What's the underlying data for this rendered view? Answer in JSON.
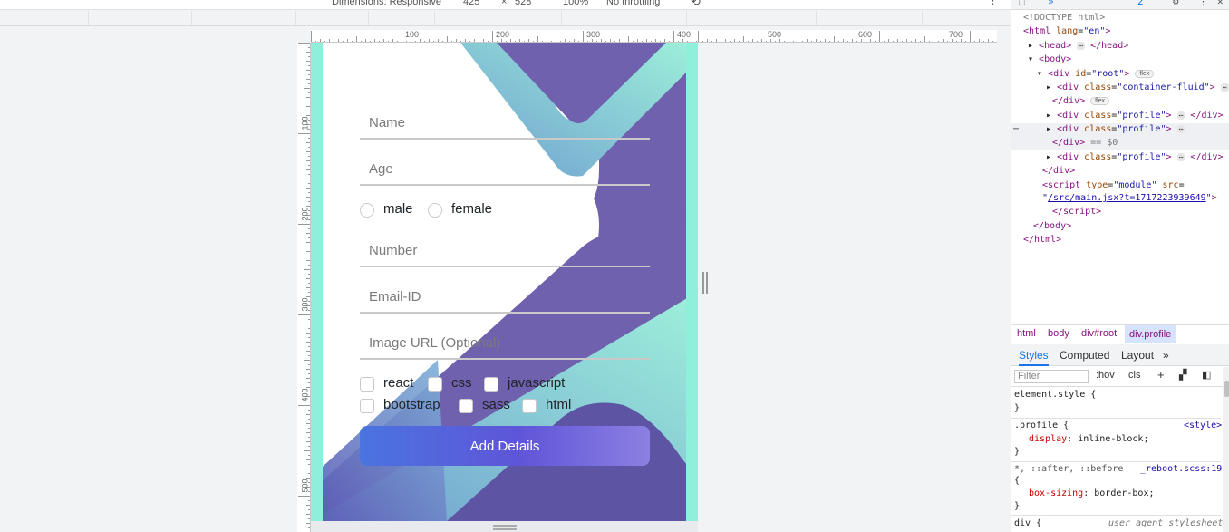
{
  "toolbar": {
    "dimensions_label": "Dimensions: Responsive",
    "width_value": "425",
    "x_sep": "×",
    "height_value": "528",
    "zoom": "100%",
    "throttling": "No throttling"
  },
  "ruler": {
    "h_ticks": [
      "100",
      "200",
      "300",
      "400",
      "500",
      "600",
      "700"
    ],
    "v_ticks": [
      "100",
      "200",
      "300",
      "400",
      "500"
    ]
  },
  "form": {
    "name_placeholder": "Name",
    "age_placeholder": "Age",
    "gender_options": [
      "male",
      "female"
    ],
    "number_placeholder": "Number",
    "email_placeholder": "Email-ID",
    "image_placeholder": "Image URL (Optional)",
    "skills_row1": [
      "react",
      "css",
      "javascript"
    ],
    "skills_row2": [
      "bootstrap",
      "sass",
      "html"
    ],
    "submit_label": "Add Details"
  },
  "colors": {
    "purple": "#6f61ad",
    "dark_purple": "#5d54a4",
    "teal": "#8ef0da",
    "blue": "#6f9fd0"
  },
  "devtools": {
    "top_badge": "2",
    "dom": {
      "doctype": "<!DOCTYPE html>",
      "html_open": "html",
      "html_attr": "lang",
      "html_val": "\"en\"",
      "head": "head",
      "body": "body",
      "root_id": "\"root\"",
      "flex_pill": "flex",
      "container_class": "\"container-fluid\"",
      "profile_class": "\"profile\"",
      "eq_ref": "== $0",
      "script_type": "\"module\"",
      "script_src": "/src/main.jsx?t=1717223939649"
    },
    "breadcrumbs": [
      "html",
      "body",
      "div#root",
      "div.profile"
    ],
    "tabs": [
      "Styles",
      "Computed",
      "Layout"
    ],
    "filter_placeholder": "Filter",
    "hov": ":hov",
    "cls": ".cls",
    "styles": {
      "element_style": "element.style {",
      "profile_selector": ".profile {",
      "profile_source": "<style>",
      "profile_prop": "display",
      "profile_value": "inline-block;",
      "universal_selector": "*, ::after, ::before",
      "universal_source": "_reboot.scss:19",
      "universal_prop": "box-sizing",
      "universal_value": "border-box;",
      "div_selector": "div {",
      "div_source": "user agent stylesheet"
    }
  }
}
